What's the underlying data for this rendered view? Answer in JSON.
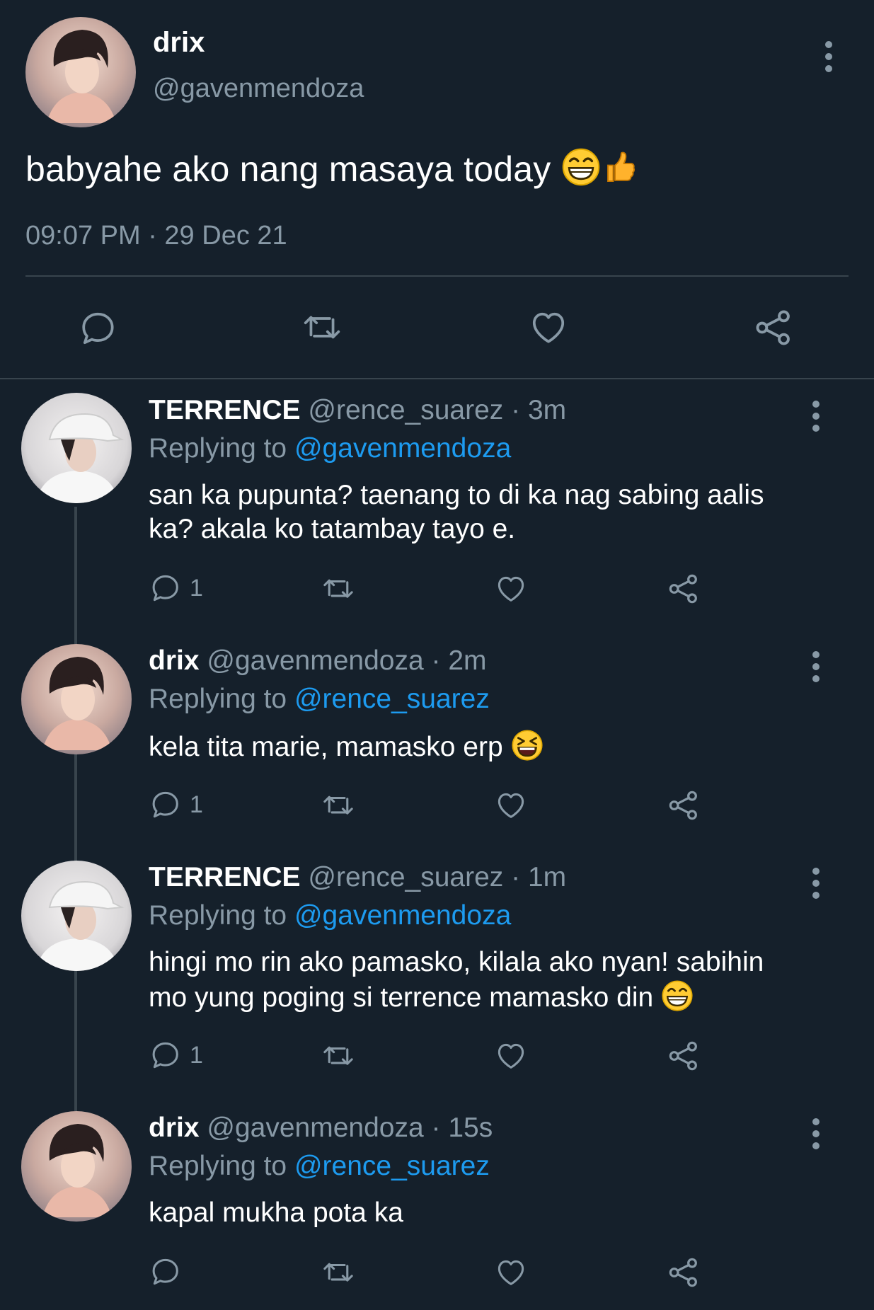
{
  "main": {
    "name": "drix",
    "handle": "@gavenmendoza",
    "text": "babyahe ako nang masaya today",
    "emojis": [
      "grinning-face",
      "thumbs-up"
    ],
    "timestamp": "09:07 PM · 29 Dec 21",
    "actions": [
      "reply-icon",
      "retweet-icon",
      "like-icon",
      "share-icon"
    ]
  },
  "replies": [
    {
      "name": "TERRENCE",
      "handle": "@rence_suarez",
      "time": "· 3m",
      "replying_label": "Replying to",
      "replying_to": "@gavenmendoza",
      "text_lines": [
        "san ka pupunta? taenang to di ka nag sabing aalis",
        "ka? akala ko tatambay tayo e."
      ],
      "reply_count": "1"
    },
    {
      "name": "drix",
      "handle": "@gavenmendoza",
      "time": "· 2m",
      "replying_label": "Replying to",
      "replying_to": "@rence_suarez",
      "text_lines": [
        "kela tita marie, mamasko erp"
      ],
      "emoji": "squinting-face",
      "reply_count": "1"
    },
    {
      "name": "TERRENCE",
      "handle": "@rence_suarez",
      "time": "· 1m",
      "replying_label": "Replying to",
      "replying_to": "@gavenmendoza",
      "text_lines": [
        "hingi mo rin ako pamasko, kilala ako nyan! sabihin",
        "mo yung poging si terrence mamasko din"
      ],
      "emoji": "grinning-face",
      "reply_count": "1"
    },
    {
      "name": "drix",
      "handle": "@gavenmendoza",
      "time": "· 15s",
      "replying_label": "Replying to",
      "replying_to": "@rence_suarez",
      "text_lines": [
        "kapal mukha pota ka"
      ],
      "reply_count": ""
    }
  ],
  "colors": {
    "background": "#15202b",
    "muted": "#8899a6",
    "link": "#1d9bf0",
    "divider": "#38444d"
  }
}
